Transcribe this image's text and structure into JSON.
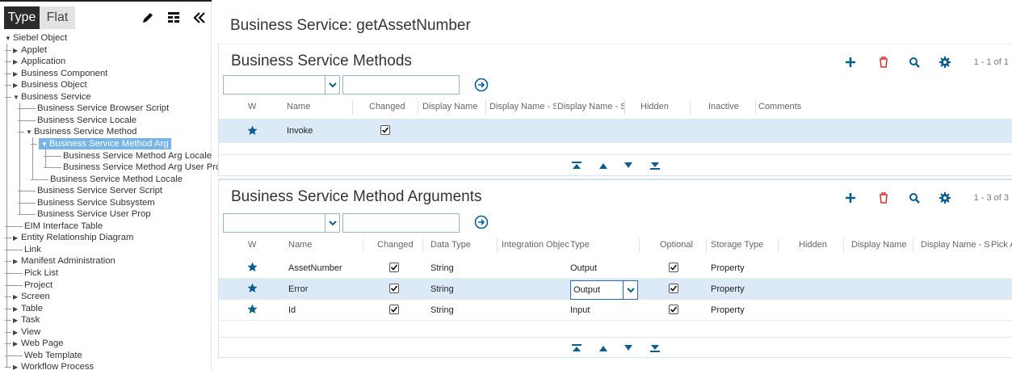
{
  "left_panel": {
    "tabs": [
      "Type",
      "Flat"
    ],
    "tree": [
      {
        "label": "Siebel Object",
        "depth": 0,
        "toggle": "expanded"
      },
      {
        "label": "Applet",
        "depth": 1,
        "toggle": "collapsed"
      },
      {
        "label": "Application",
        "depth": 1,
        "toggle": "collapsed"
      },
      {
        "label": "Business Component",
        "depth": 1,
        "toggle": "collapsed"
      },
      {
        "label": "Business Object",
        "depth": 1,
        "toggle": "collapsed"
      },
      {
        "label": "Business Service",
        "depth": 1,
        "toggle": "expanded"
      },
      {
        "label": "Business Service Browser Script",
        "depth": 2,
        "toggle": "none"
      },
      {
        "label": "Business Service Locale",
        "depth": 2,
        "toggle": "none"
      },
      {
        "label": "Business Service Method",
        "depth": 2,
        "toggle": "expanded"
      },
      {
        "label": "Business Service Method Arg",
        "depth": 3,
        "toggle": "expanded",
        "selected": true
      },
      {
        "label": "Business Service Method Arg Locale",
        "depth": 4,
        "toggle": "none"
      },
      {
        "label": "Business Service Method Arg User Prop",
        "depth": 4,
        "toggle": "none"
      },
      {
        "label": "Business Service Method Locale",
        "depth": 3,
        "toggle": "none"
      },
      {
        "label": "Business Service Server Script",
        "depth": 2,
        "toggle": "none"
      },
      {
        "label": "Business Service Subsystem",
        "depth": 2,
        "toggle": "none"
      },
      {
        "label": "Business Service User Prop",
        "depth": 2,
        "toggle": "none"
      },
      {
        "label": "EIM Interface Table",
        "depth": 1,
        "toggle": "none"
      },
      {
        "label": "Entity Relationship Diagram",
        "depth": 1,
        "toggle": "collapsed"
      },
      {
        "label": "Link",
        "depth": 1,
        "toggle": "none"
      },
      {
        "label": "Manifest Administration",
        "depth": 1,
        "toggle": "collapsed"
      },
      {
        "label": "Pick List",
        "depth": 1,
        "toggle": "none"
      },
      {
        "label": "Project",
        "depth": 1,
        "toggle": "none"
      },
      {
        "label": "Screen",
        "depth": 1,
        "toggle": "collapsed"
      },
      {
        "label": "Table",
        "depth": 1,
        "toggle": "collapsed"
      },
      {
        "label": "Task",
        "depth": 1,
        "toggle": "collapsed"
      },
      {
        "label": "View",
        "depth": 1,
        "toggle": "collapsed"
      },
      {
        "label": "Web Page",
        "depth": 1,
        "toggle": "collapsed"
      },
      {
        "label": "Web Template",
        "depth": 1,
        "toggle": "none"
      },
      {
        "label": "Workflow Process",
        "depth": 1,
        "toggle": "collapsed"
      }
    ]
  },
  "page": {
    "title": "Business Service: getAssetNumber"
  },
  "methods": {
    "title": "Business Service Methods",
    "count": "1 - 1 of 1",
    "columns": [
      "W",
      "Name",
      "Changed",
      "Display Name",
      "Display Name - S",
      "Display Name - S",
      "Hidden",
      "Inactive",
      "Comments"
    ],
    "rows": [
      {
        "w": "star",
        "name": "Invoke",
        "changed": true
      }
    ]
  },
  "arguments": {
    "title": "Business Service Method Arguments",
    "count": "1 - 3 of 3",
    "columns": [
      "W",
      "Name",
      "Changed",
      "Data Type",
      "Integration Object",
      "Type",
      "Optional",
      "Storage Type",
      "Hidden",
      "Display Name",
      "Display Name - St",
      "Pick A"
    ],
    "rows": [
      {
        "name": "AssetNumber",
        "changed": true,
        "data_type": "String",
        "type": "Output",
        "optional": true,
        "storage_type": "Property"
      },
      {
        "name": "Error",
        "changed": true,
        "data_type": "String",
        "type": "Output",
        "optional": true,
        "storage_type": "Property",
        "editing": true
      },
      {
        "name": "Id",
        "changed": true,
        "data_type": "String",
        "type": "Input",
        "optional": true,
        "storage_type": "Property"
      }
    ]
  },
  "colors": {
    "accent": "#0b5e8f",
    "delete": "#d32f2f",
    "selected_row": "#dbeaf6",
    "tree_selected": "#76b5e6"
  },
  "icons": [
    "pencil-icon",
    "columns-icon",
    "collapse-icon",
    "add-icon",
    "delete-icon",
    "search-icon",
    "settings-icon",
    "go-icon",
    "first-icon",
    "prev-icon",
    "next-icon",
    "last-icon",
    "star-icon"
  ]
}
